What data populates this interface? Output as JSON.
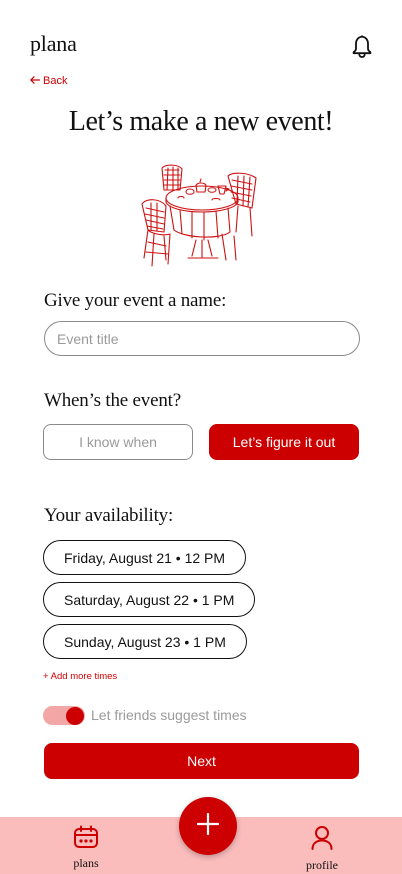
{
  "header": {
    "app_title": "plana",
    "back_label": "Back"
  },
  "page": {
    "title": "Let’s make a new event!"
  },
  "name_section": {
    "label": "Give your event a name:",
    "placeholder": "Event title",
    "value": ""
  },
  "when_section": {
    "label": "When’s the event?",
    "option_known": "I know when",
    "option_figure": "Let’s figure it out",
    "selected": "Let’s figure it out"
  },
  "availability": {
    "label": "Your availability:",
    "slots": [
      "Friday, August 21 • 12 PM",
      "Saturday, August 22 • 1 PM",
      "Sunday, August 23 • 1 PM"
    ],
    "add_more": "+ Add more times",
    "suggest_label": "Let friends suggest times",
    "suggest_enabled": true
  },
  "actions": {
    "next_label": "Next"
  },
  "tabbar": {
    "plans_label": "plans",
    "profile_label": "profile"
  },
  "colors": {
    "accent": "#cc0000",
    "tabbar_bg": "#fbbcbc",
    "toggle_track": "#f3a6a6"
  },
  "icons": {
    "notifications": "bell-icon",
    "back": "arrow-left-icon",
    "plans": "calendar-icon",
    "profile": "person-icon",
    "create": "plus-icon",
    "illustration": "cafe-table-illustration"
  }
}
